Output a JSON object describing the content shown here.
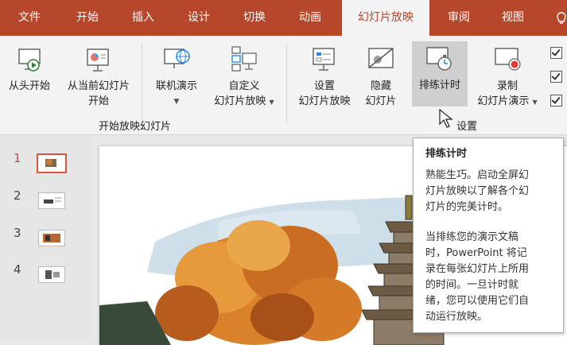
{
  "tabs": [
    "文件",
    "开始",
    "插入",
    "设计",
    "切换",
    "动画",
    "幻灯片放映",
    "审阅",
    "视图"
  ],
  "tab_active": "幻灯片放映",
  "ribbon": {
    "from_beginning": "从头开始",
    "from_current_l1": "从当前幻灯片",
    "from_current_l2": "开始",
    "online_present": "联机演示",
    "custom_l1": "自定义",
    "custom_l2": "幻灯片放映",
    "setup_l1": "设置",
    "setup_l2": "幻灯片放映",
    "hide_l1": "隐藏",
    "hide_l2": "幻灯片",
    "rehearse": "排练计时",
    "record_l1": "录制",
    "record_l2": "幻灯片演示",
    "group_start": "开始放映幻灯片",
    "group_setup": "设置"
  },
  "thumbnails": [
    "1",
    "2",
    "3",
    "4"
  ],
  "selected_thumbnail": "1",
  "tooltip": {
    "title": "排练计时",
    "para1_l1": "熟能生巧。启动全屏幻",
    "para1_l2": "灯片放映以了解各个幻",
    "para1_l3": "灯片的完美计时。",
    "para2_l1": "当排练您的演示文稿",
    "para2_l2": "时，PowerPoint 将记",
    "para2_l3": "录在每张幻灯片上所用",
    "para2_l4": "的时间。一旦计时就",
    "para2_l5": "绪，您可以使用它们自",
    "para2_l6": "动运行放映。"
  },
  "colors": {
    "brand": "#b7472a",
    "ribbon_bg": "#f3f3f3",
    "selected_thumb_border": "#d9553f"
  }
}
